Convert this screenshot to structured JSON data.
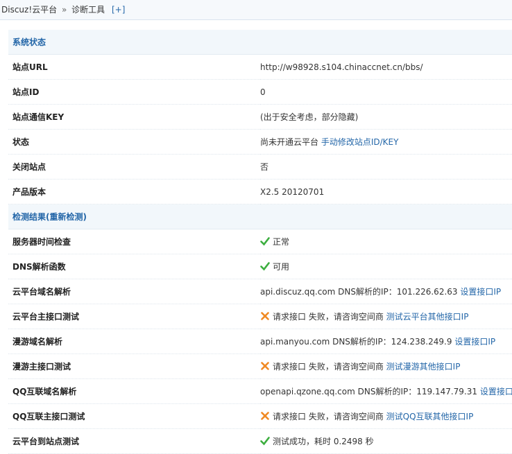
{
  "breadcrumb": {
    "part1": "Discuz!云平台",
    "sep": "»",
    "part2": "诊断工具",
    "plus": "[+]"
  },
  "colors": {
    "link": "#2366a8",
    "ok": "#3cae3f",
    "error": "#f08a24"
  },
  "system": {
    "title": "系统状态",
    "rows": [
      {
        "label": "站点URL",
        "value": "http://w98928.s104.chinaccnet.cn/bbs/"
      },
      {
        "label": "站点ID",
        "value": "0"
      },
      {
        "label": "站点通信KEY",
        "value": "(出于安全考虑，部分隐藏)"
      },
      {
        "label": "状态",
        "value": "尚未开通云平台",
        "link": "手动修改站点ID/KEY"
      },
      {
        "label": "关闭站点",
        "value": "否"
      },
      {
        "label": "产品版本",
        "value": "X2.5 20120701"
      }
    ]
  },
  "check": {
    "title": "检测结果",
    "recheck_open": "(",
    "recheck": "重新检测",
    "recheck_close": ")",
    "rows": [
      {
        "label": "服务器时间检查",
        "icon": "check-icon",
        "value": "正常"
      },
      {
        "label": "DNS解析函数",
        "icon": "check-icon",
        "value": "可用"
      },
      {
        "label": "云平台域名解析",
        "value": "api.discuz.qq.com DNS解析的IP：101.226.62.63",
        "link": "设置接口IP"
      },
      {
        "label": "云平台主接口测试",
        "icon": "cross-icon",
        "value": "请求接口 失败，请咨询空间商",
        "link": "测试云平台其他接口IP"
      },
      {
        "label": "漫游域名解析",
        "value": "api.manyou.com DNS解析的IP：124.238.249.9",
        "link": "设置接口IP"
      },
      {
        "label": "漫游主接口测试",
        "icon": "cross-icon",
        "value": "请求接口 失败，请咨询空间商",
        "link": "测试漫游其他接口IP"
      },
      {
        "label": "QQ互联域名解析",
        "value": "openapi.qzone.qq.com DNS解析的IP：119.147.79.31",
        "link": "设置接口IP"
      },
      {
        "label": "QQ互联主接口测试",
        "icon": "cross-icon",
        "value": "请求接口 失败，请咨询空间商",
        "link": "测试QQ互联其他接口IP"
      },
      {
        "label": "云平台到站点测试",
        "icon": "check-icon",
        "value": "测试成功，耗时 0.2498 秒"
      }
    ]
  }
}
